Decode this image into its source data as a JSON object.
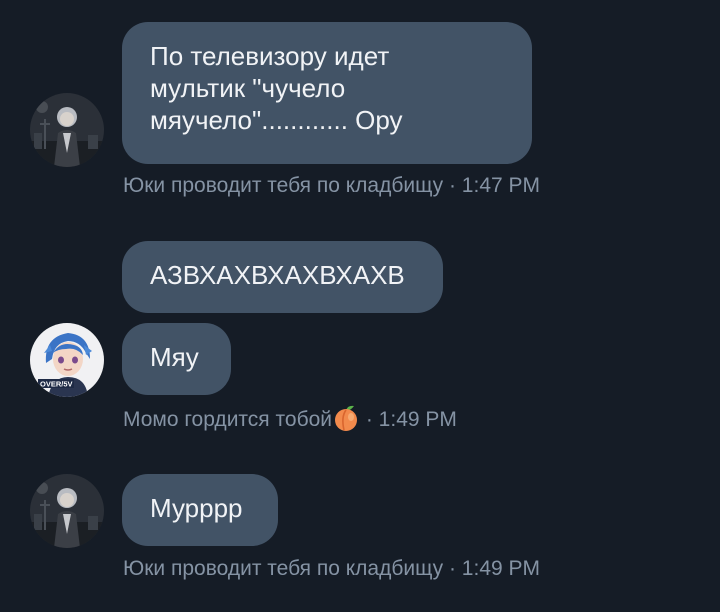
{
  "messages": [
    {
      "lines": [
        "По телевизору идет",
        "мультик \"чучело",
        "мяучело\"............ Ору"
      ]
    },
    {
      "caption_name": "Юки проводит тебя по кладбищу",
      "caption_time": " · 1:47 PM"
    },
    {
      "text": "АЗВХАХВХАХВХАХВ"
    },
    {
      "text": "Мяу",
      "caption_name": "Момо гордится тобой",
      "caption_time": " · 1:49 PM",
      "caption_emoji": "peach-emoji",
      "avatar_badge": "OVER/5V"
    },
    {
      "text": "Мурррр",
      "caption_name": "Юки проводит тебя по кладбищу",
      "caption_time": " · 1:49 PM"
    }
  ],
  "colors": {
    "background": "#151c26",
    "bubble": "#425366",
    "bubble_text": "#f1f3f6",
    "caption_text": "#8593a4"
  },
  "icons": {
    "yuki_avatar": "dark-graveyard-character-avatar",
    "momo_avatar": "anime-boy-blue-hair-avatar",
    "peach": "peach-emoji"
  }
}
